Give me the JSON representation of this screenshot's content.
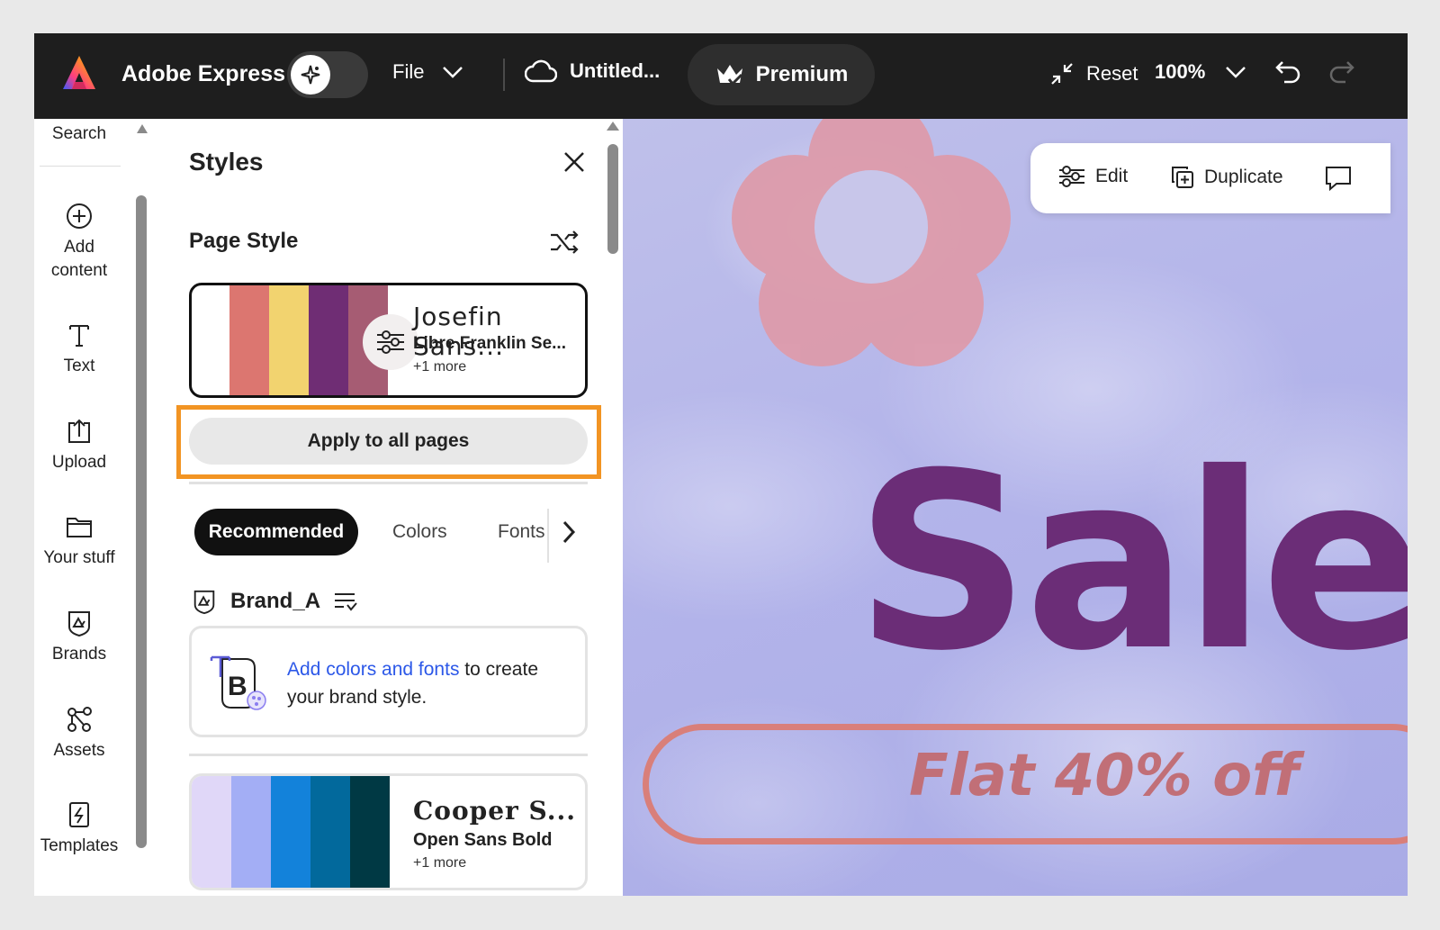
{
  "topbar": {
    "app_name": "Adobe Express",
    "file_label": "File",
    "doc_title": "Untitled...",
    "premium_label": "Premium",
    "reset_label": "Reset",
    "zoom_level": "100%"
  },
  "rail": {
    "search_label": "Search",
    "items": [
      {
        "label": "Add content",
        "icon": "plus-circle-icon"
      },
      {
        "label": "Text",
        "icon": "text-icon"
      },
      {
        "label": "Upload",
        "icon": "upload-icon"
      },
      {
        "label": "Your stuff",
        "icon": "folder-icon"
      },
      {
        "label": "Brands",
        "icon": "brand-icon"
      },
      {
        "label": "Assets",
        "icon": "assets-icon"
      },
      {
        "label": "Templates",
        "icon": "templates-icon"
      }
    ]
  },
  "panel": {
    "title": "Styles",
    "page_style_title": "Page Style",
    "current_style": {
      "swatches": [
        "#dc7670",
        "#f2d36f",
        "#6f2d74",
        "#a65c73"
      ],
      "heading_font": "Josefin Sans...",
      "body_font": "Libre Franklin Se...",
      "more": "+1 more"
    },
    "apply_label": "Apply to all pages",
    "tabs": [
      "Recommended",
      "Colors",
      "Fonts"
    ],
    "brand_name": "Brand_A",
    "brand_card": {
      "link_text": "Add colors and fonts",
      "rest_text": " to create your brand style."
    },
    "style_2": {
      "swatches": [
        "#e0d7f8",
        "#a3aef5",
        "#1382da",
        "#02699c",
        "#003944"
      ],
      "heading_font": "Cooper S...",
      "body_font": "Open Sans Bold",
      "more": "+1 more"
    }
  },
  "canvas": {
    "toolbar": {
      "edit_label": "Edit",
      "duplicate_label": "Duplicate"
    },
    "headline": "Sale",
    "offer": "Flat 40% off",
    "colors": {
      "headline": "#6b2d77",
      "offer": "#c16f77",
      "flower": "#de9aa9"
    }
  },
  "colors": {
    "highlight": "#f29423",
    "link": "#2c58e8",
    "topbar": "#1e1e1e"
  }
}
